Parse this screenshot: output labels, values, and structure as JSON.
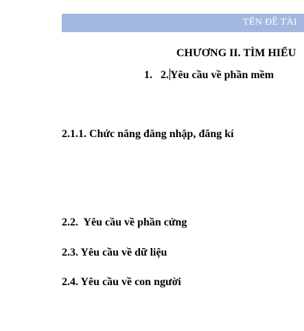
{
  "header": {
    "title": "TÊN ĐỀ TÀI",
    "band_color": "#a4b8df"
  },
  "chapter": {
    "title": "CHƯƠNG II. TÌM HIỂU"
  },
  "numbered_item": {
    "number": "1.",
    "text_before_cursor": "2.",
    "text_after_cursor": "Yêu cầu về phần mềm"
  },
  "sections": [
    {
      "label": "2.1.1. Chức năng đăng nhập, đăng kí"
    },
    {
      "label": "2.2.  Yêu cầu về phần cứng"
    },
    {
      "label": "2.3. Yêu cầu về dữ liệu"
    },
    {
      "label": "2.4. Yêu cầu về con người"
    }
  ]
}
